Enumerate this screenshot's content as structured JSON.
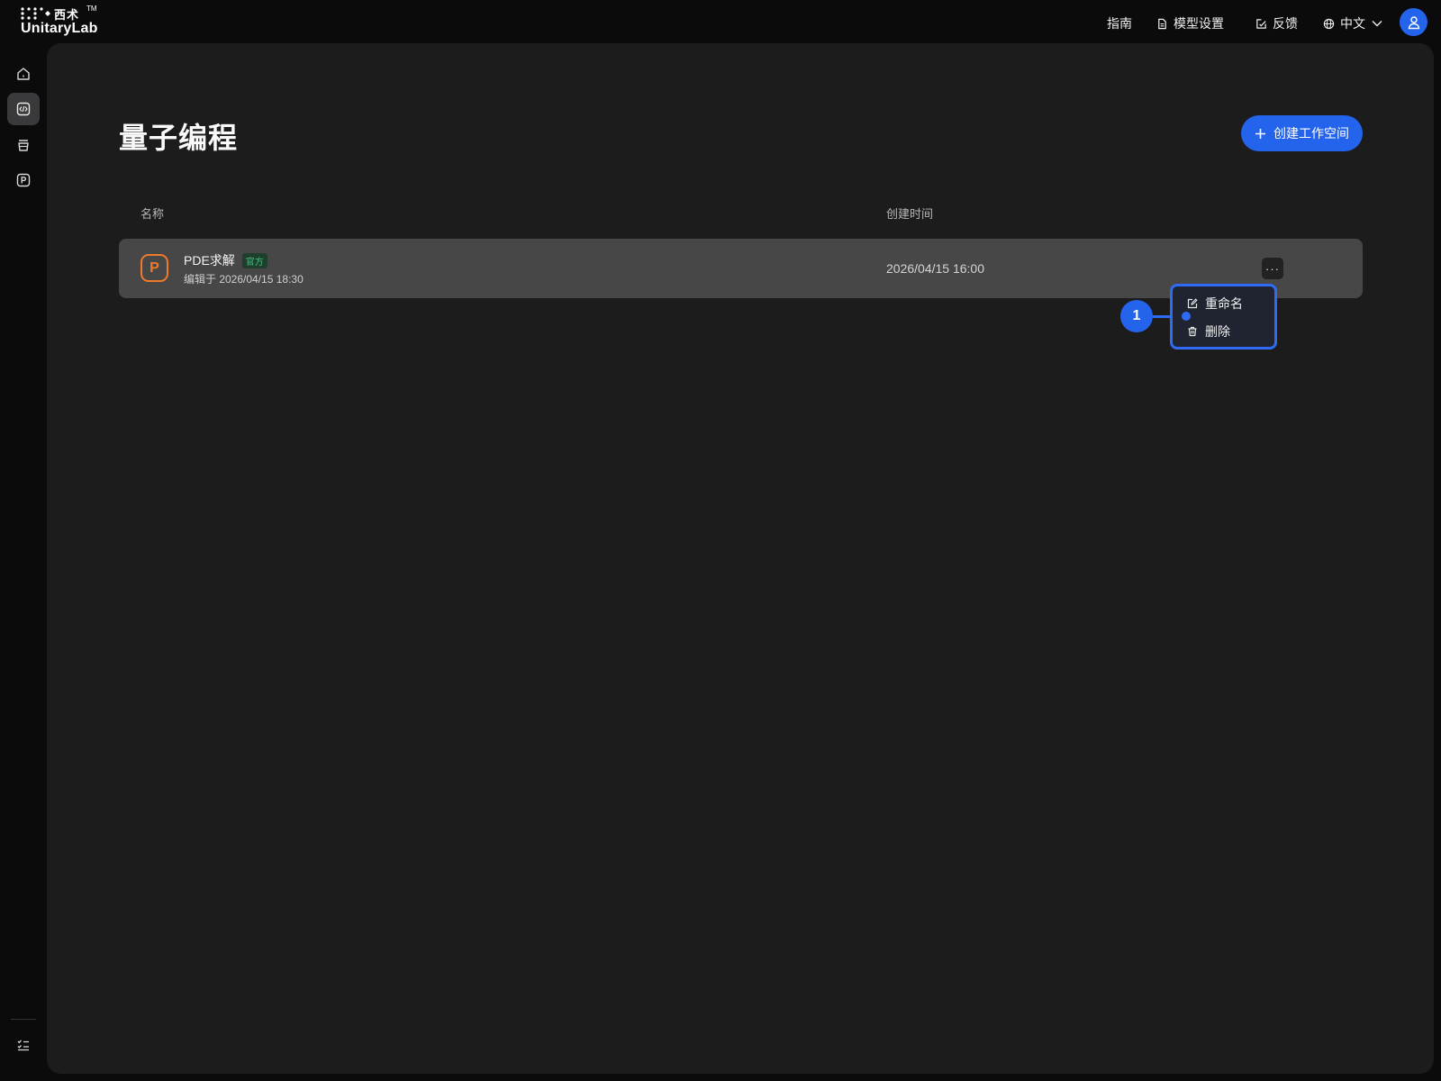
{
  "brand": {
    "cn": "西术",
    "en": "UnitaryLab",
    "tm": "TM"
  },
  "topnav": {
    "guide": "指南",
    "model_settings": "模型设置",
    "feedback": "反馈",
    "language": "中文"
  },
  "sidebar": {
    "items": [
      {
        "icon": "home-icon"
      },
      {
        "icon": "code-icon",
        "active": true
      },
      {
        "icon": "stack-icon"
      },
      {
        "icon": "p-square-icon"
      }
    ],
    "bottom_icon": "task-list-icon"
  },
  "main": {
    "title": "量子编程",
    "create_button": "创建工作空间",
    "table": {
      "columns": [
        "名称",
        "创建时间"
      ],
      "rows": [
        {
          "name": "PDE求解",
          "badge": "官方",
          "edited": "编辑于 2026/04/15 18:30",
          "created": "2026/04/15 16:00",
          "icon_letter": "P"
        }
      ]
    },
    "more_button": "···",
    "context_menu": {
      "rename": "重命名",
      "delete": "删除"
    },
    "annotation": "1"
  },
  "colors": {
    "accent": "#2463eb",
    "brand_orange": "#f07a2a",
    "badge_green": "#3fbf7a"
  }
}
